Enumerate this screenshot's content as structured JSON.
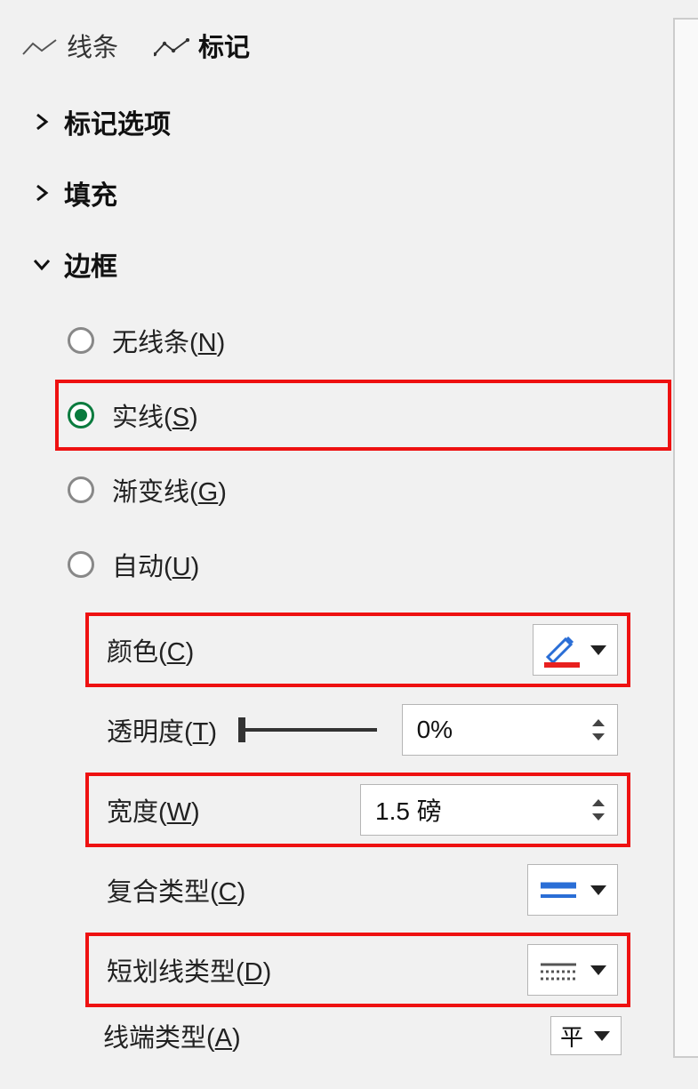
{
  "tabs": {
    "line": "线条",
    "marker": "标记"
  },
  "sections": {
    "markerOptions": "标记选项",
    "fill": "填充",
    "border": "边框"
  },
  "border": {
    "radios": {
      "noLine": {
        "text": "无线条(",
        "accel": "N",
        "close": ")"
      },
      "solid": {
        "text": "实线(",
        "accel": "S",
        "close": ")"
      },
      "gradient": {
        "text": "渐变线(",
        "accel": "G",
        "close": ")"
      },
      "auto": {
        "text": "自动(",
        "accel": "U",
        "close": ")"
      }
    },
    "props": {
      "color": {
        "label_a": "颜色(",
        "accel": "C",
        "label_b": ")"
      },
      "transparency": {
        "label_a": "透明度(",
        "accel": "T",
        "label_b": ")",
        "value": "0%"
      },
      "width": {
        "label_a": "宽度(",
        "accel": "W",
        "label_b": ")",
        "value": "1.5 磅"
      },
      "compound": {
        "label_a": "复合类型(",
        "accel": "C",
        "label_b": ")"
      },
      "dash": {
        "label_a": "短划线类型(",
        "accel": "D",
        "label_b": ")"
      },
      "cap": {
        "label_a": "线端类型(",
        "accel": "A",
        "label_b": ")",
        "value": "平"
      }
    }
  },
  "colors": {
    "accent_red": "#e11",
    "accent_green": "#0a7b3e",
    "line_blue": "#2a6ed6",
    "swatch_red": "#e8201f"
  }
}
